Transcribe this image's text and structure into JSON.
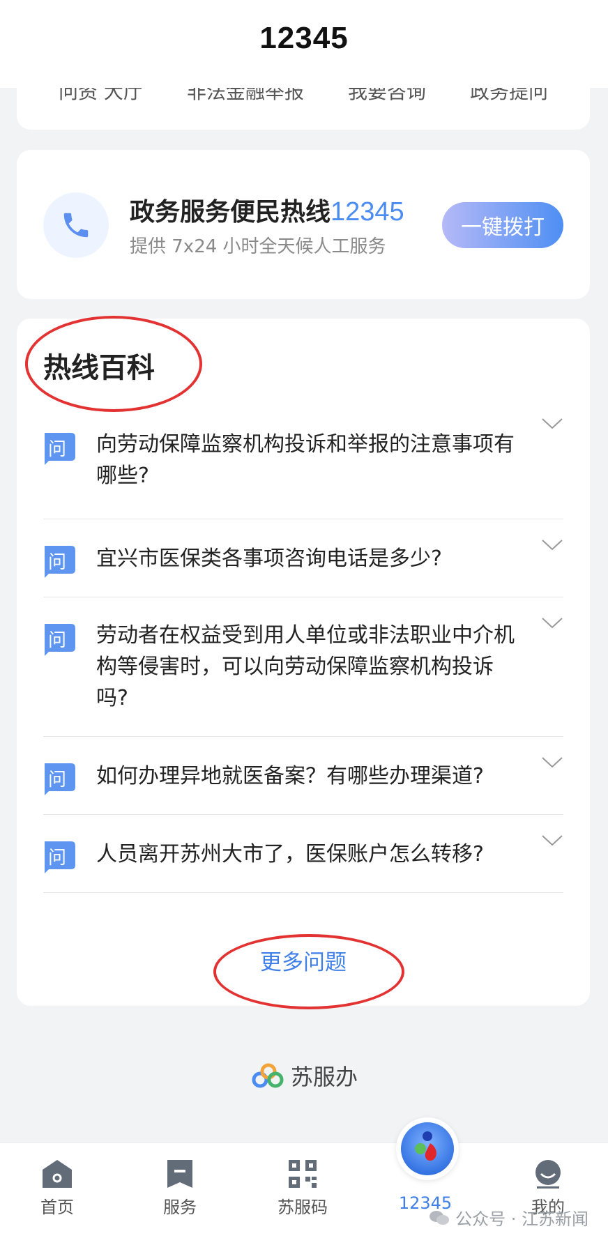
{
  "header": {
    "title": "12345"
  },
  "top_card": {
    "items": [
      "问资  大厅",
      "非法金融举报",
      "我要咨询",
      "政务提问"
    ]
  },
  "hotline": {
    "title": "政务服务便民热线",
    "number": "12345",
    "subtitle": "提供 7x24 小时全天候人工服务",
    "call_label": "一键拨打"
  },
  "faq": {
    "title": "热线百科",
    "badge": "问",
    "items": [
      {
        "question": "向劳动保障监察机构投诉和举报的注意事项有哪些?"
      },
      {
        "question": "宜兴市医保类各事项咨询电话是多少?"
      },
      {
        "question": "劳动者在权益受到用人单位或非法职业中介机构等侵害时，可以向劳动保障监察机构投诉吗?"
      },
      {
        "question": "如何办理异地就医备案？有哪些办理渠道?"
      },
      {
        "question": "人员离开苏州大市了，医保账户怎么转移?"
      }
    ],
    "more_label": "更多问题"
  },
  "brand": {
    "name": "苏服办"
  },
  "tabbar": {
    "items": [
      {
        "label": "首页",
        "icon": "home-icon"
      },
      {
        "label": "服务",
        "icon": "service-icon"
      },
      {
        "label": "苏服码",
        "icon": "qr-code-icon"
      },
      {
        "label": "12345",
        "icon": "hotline-logo-icon",
        "active": true
      },
      {
        "label": "我的",
        "icon": "profile-icon"
      }
    ]
  },
  "watermark": {
    "text": "公众号 · 江苏新闻"
  },
  "colors": {
    "accent": "#4a8cf2",
    "annotation_red": "#e33232"
  }
}
